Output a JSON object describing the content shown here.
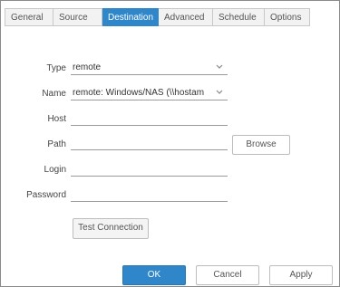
{
  "tabs": [
    {
      "label": "General",
      "active": false
    },
    {
      "label": "Source",
      "active": false
    },
    {
      "label": "Destination",
      "active": true
    },
    {
      "label": "Advanced",
      "active": false
    },
    {
      "label": "Schedule",
      "active": false
    },
    {
      "label": "Options",
      "active": false
    }
  ],
  "form": {
    "type": {
      "label": "Type",
      "value": "remote",
      "icon": "chevron-down-icon"
    },
    "name": {
      "label": "Name",
      "value": "remote: Windows/NAS (\\\\hostam",
      "icon": "chevron-down-icon"
    },
    "host": {
      "label": "Host",
      "value": ""
    },
    "path": {
      "label": "Path",
      "value": "",
      "browse_label": "Browse"
    },
    "login": {
      "label": "Login",
      "value": ""
    },
    "password": {
      "label": "Password",
      "value": ""
    },
    "test_connection_label": "Test Connection"
  },
  "footer": {
    "ok_label": "OK",
    "cancel_label": "Cancel",
    "apply_label": "Apply"
  },
  "colors": {
    "accent": "#2f86c9",
    "border": "#c8c8c8"
  }
}
